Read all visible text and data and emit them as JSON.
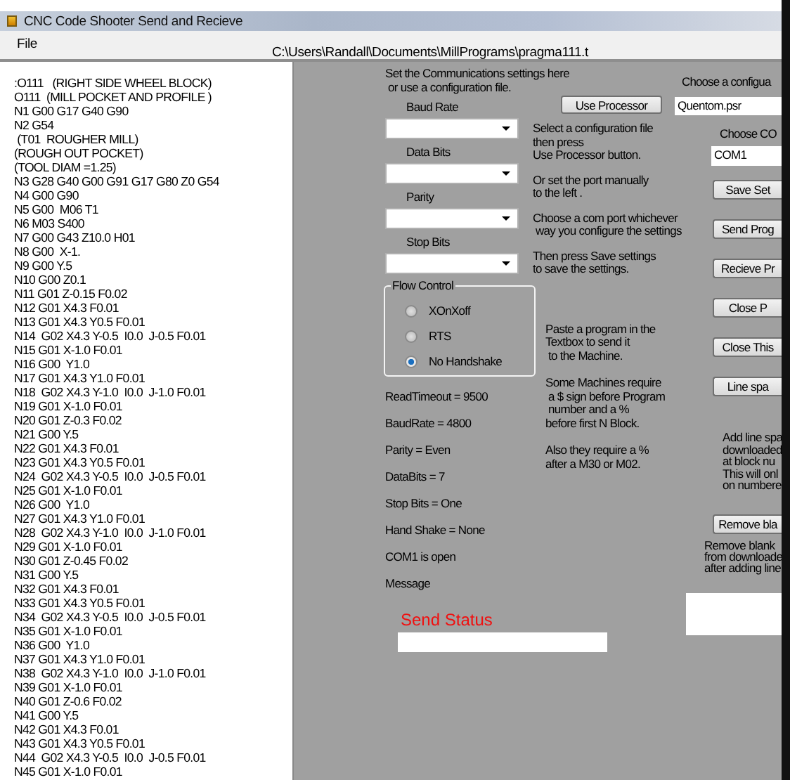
{
  "window": {
    "title": "CNC Code Shooter Send and Recieve"
  },
  "menu": [
    {
      "label": "File"
    }
  ],
  "file_path": "C:\\Users\\Randall\\Documents\\MillPrograms\\pragma111.t",
  "program_text": [
    ":O111   (RIGHT SIDE WHEEL BLOCK)",
    "O111  (MILL POCKET AND PROFILE )",
    "N1 G00 G17 G40 G90",
    "N2 G54",
    " (T01  ROUGHER MILL)",
    "(ROUGH OUT POCKET)",
    "(TOOL DIAM =1.25)",
    "N3 G28 G40 G00 G91 G17 G80 Z0 G54",
    "N4 G00 G90",
    "N5 G00  M06 T1",
    "N6 M03 S400",
    "N7 G00 G43 Z10.0 H01",
    "N8 G00  X-1.",
    "N9 G00 Y.5",
    "N10 G00 Z0.1",
    "N11 G01 Z-0.15 F0.02",
    "N12 G01 X4.3 F0.01",
    "N13 G01 X4.3 Y0.5 F0.01",
    "N14  G02 X4.3 Y-0.5  I0.0  J-0.5 F0.01",
    "N15 G01 X-1.0 F0.01",
    "N16 G00  Y1.0",
    "N17 G01 X4.3 Y1.0 F0.01",
    "N18  G02 X4.3 Y-1.0  I0.0  J-1.0 F0.01",
    "N19 G01 X-1.0 F0.01",
    "N20 G01 Z-0.3 F0.02",
    "N21 G00 Y.5",
    "N22 G01 X4.3 F0.01",
    "N23 G01 X4.3 Y0.5 F0.01",
    "N24  G02 X4.3 Y-0.5  I0.0  J-0.5 F0.01",
    "N25 G01 X-1.0 F0.01",
    "N26 G00  Y1.0",
    "N27 G01 X4.3 Y1.0 F0.01",
    "N28  G02 X4.3 Y-1.0  I0.0  J-1.0 F0.01",
    "N29 G01 X-1.0 F0.01",
    "N30 G01 Z-0.45 F0.02",
    "N31 G00 Y.5",
    "N32 G01 X4.3 F0.01",
    "N33 G01 X4.3 Y0.5 F0.01",
    "N34  G02 X4.3 Y-0.5  I0.0  J-0.5 F0.01",
    "N35 G01 X-1.0 F0.01",
    "N36 G00  Y1.0",
    "N37 G01 X4.3 Y1.0 F0.01",
    "N38  G02 X4.3 Y-1.0  I0.0  J-1.0 F0.01",
    "N39 G01 X-1.0 F0.01",
    "N40 G01 Z-0.6 F0.02",
    "N41 G00 Y.5",
    "N42 G01 X4.3 F0.01",
    "N43 G01 X4.3 Y0.5 F0.01",
    "N44  G02 X4.3 Y-0.5  I0.0  J-0.5 F0.01",
    "N45 G01 X-1.0 F0.01"
  ],
  "settings": {
    "intro": "Set the Communications settings here\n or use a configuration file.",
    "fields": [
      {
        "label": "Baud Rate"
      },
      {
        "label": "Data Bits"
      },
      {
        "label": "Parity"
      },
      {
        "label": "Stop Bits"
      }
    ],
    "flow_control": {
      "title": "Flow Control",
      "options": [
        {
          "label": "XOnXoff",
          "selected": false
        },
        {
          "label": "RTS",
          "selected": false
        },
        {
          "label": "No Handshake",
          "selected": true
        }
      ]
    },
    "status_lines": [
      "ReadTimeout = 9500",
      "BaudRate = 4800",
      "Parity = Even",
      "DataBits = 7",
      "Stop Bits = One",
      "Hand Shake = None",
      "COM1 is open"
    ],
    "message_label": "Message",
    "send_status": {
      "label": "Send Status"
    }
  },
  "use_processor_button": "Use Processor",
  "instructions": [
    "Select a configuration file\nthen press\nUse Processor button.",
    "Or set the port manually\nto the left .",
    "Choose a com port whichever\n way you configure the settings",
    "Then press Save settings\nto save the settings."
  ],
  "notes": [
    "Paste a program in the\nTextbox to send it\n to the Machine.",
    "Some Machines require\n a $ sign before Program\n number and a %\nbefore first N Block.",
    "Also they require a %\nafter a M30 or M02."
  ],
  "config": {
    "label": "Choose a configua",
    "value": "Quentom.psr"
  },
  "port": {
    "label": "Choose CO",
    "value": "COM1"
  },
  "buttons": [
    {
      "label": "Save Set"
    },
    {
      "label": "Send Prog"
    },
    {
      "label": "Recieve Pr"
    },
    {
      "label": "Close P"
    },
    {
      "label": "Close This"
    },
    {
      "label": "Line spa"
    }
  ],
  "line_space_note": "Add line spa\ndownloaded\nat block nu\nThis will onl\non numbere",
  "remove_button": "Remove bla",
  "remove_note": "Remove blank\nfrom downloade\nafter adding line"
}
